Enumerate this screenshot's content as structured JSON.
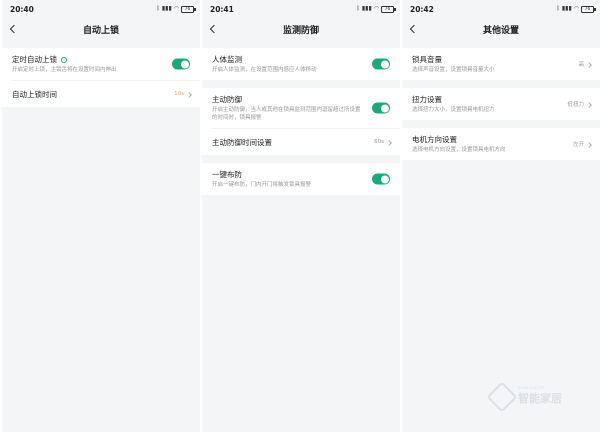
{
  "screens": [
    {
      "time": "20:40",
      "battery": "76",
      "title": "自动上锁",
      "rows": [
        {
          "title": "定时自动上锁",
          "subtitle": "开启定时上锁，主锁舌将在设置时间内伸出",
          "toggle": true
        },
        {
          "title": "自动上锁时间",
          "value": "10s"
        }
      ]
    },
    {
      "time": "20:41",
      "battery": "76",
      "title": "监测防御",
      "rows": [
        {
          "title": "人体监测",
          "subtitle": "开启人体监测，在设置范围内感应人体移动",
          "toggle": true
        },
        {
          "title": "主动防御",
          "subtitle": "开启主动防御，当人或其他在锁具监测范围内逗留超过所设置的时间时，锁具报警",
          "toggle": true
        },
        {
          "title": "主动防御时间设置",
          "value": "60s"
        },
        {
          "title": "一键布防",
          "subtitle": "开启一键布防，门内开门将触发锁具报警",
          "toggle": true
        }
      ]
    },
    {
      "time": "20:42",
      "battery": "76",
      "title": "其他设置",
      "rows": [
        {
          "title": "锁具音量",
          "subtitle": "选择声音设置，设置锁具音量大小",
          "value": "高"
        },
        {
          "title": "扭力设置",
          "subtitle": "选择扭力大小，设置锁具电机扭力",
          "value": "低扭力"
        },
        {
          "title": "电机方向设置",
          "subtitle": "选择电机方向设置，设置锁具电机方向",
          "value": "左开"
        }
      ]
    }
  ],
  "icons": {
    "back": "chevron-left-icon",
    "chevron": "chevron-right-icon",
    "info": "info-icon"
  },
  "colors": {
    "accent": "#1aaa7a",
    "background": "#f4f5f7",
    "value_orange": "#e2a338"
  },
  "watermark": {
    "small": "www.znjj.tv",
    "big": "智能家居"
  }
}
